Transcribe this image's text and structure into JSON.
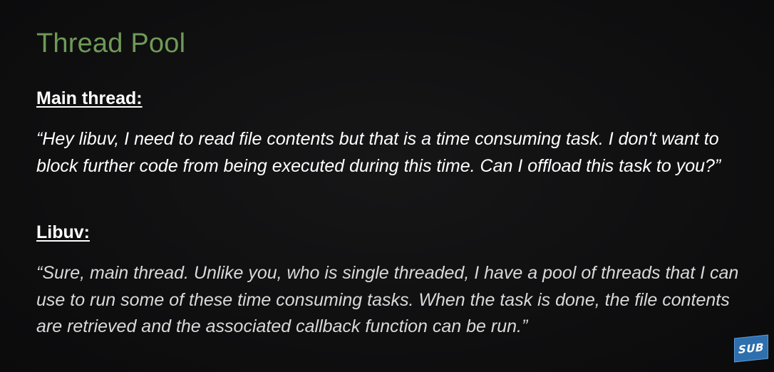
{
  "slide": {
    "title": "Thread Pool",
    "dialogue": [
      {
        "speaker": "Main thread:",
        "quote": "“Hey libuv, I need to read file contents but that is a time consuming task. I don't want to block further code from being executed during this time. Can I offload this task to you?”"
      },
      {
        "speaker": "Libuv:",
        "quote": "“Sure, main thread. Unlike you, who is single threaded, I have a pool of threads that I can use to run some of these time consuming tasks. When the task is done, the file contents are retrieved and the associated callback function can be run.”"
      }
    ]
  },
  "badge": {
    "label": "SUB",
    "color": "#2e6fae"
  },
  "colors": {
    "background": "#0f0f10",
    "title": "#6f9a57",
    "speaker": "#ffffff",
    "quote_main": "#ffffff",
    "quote_libuv": "#d9d9d9"
  }
}
